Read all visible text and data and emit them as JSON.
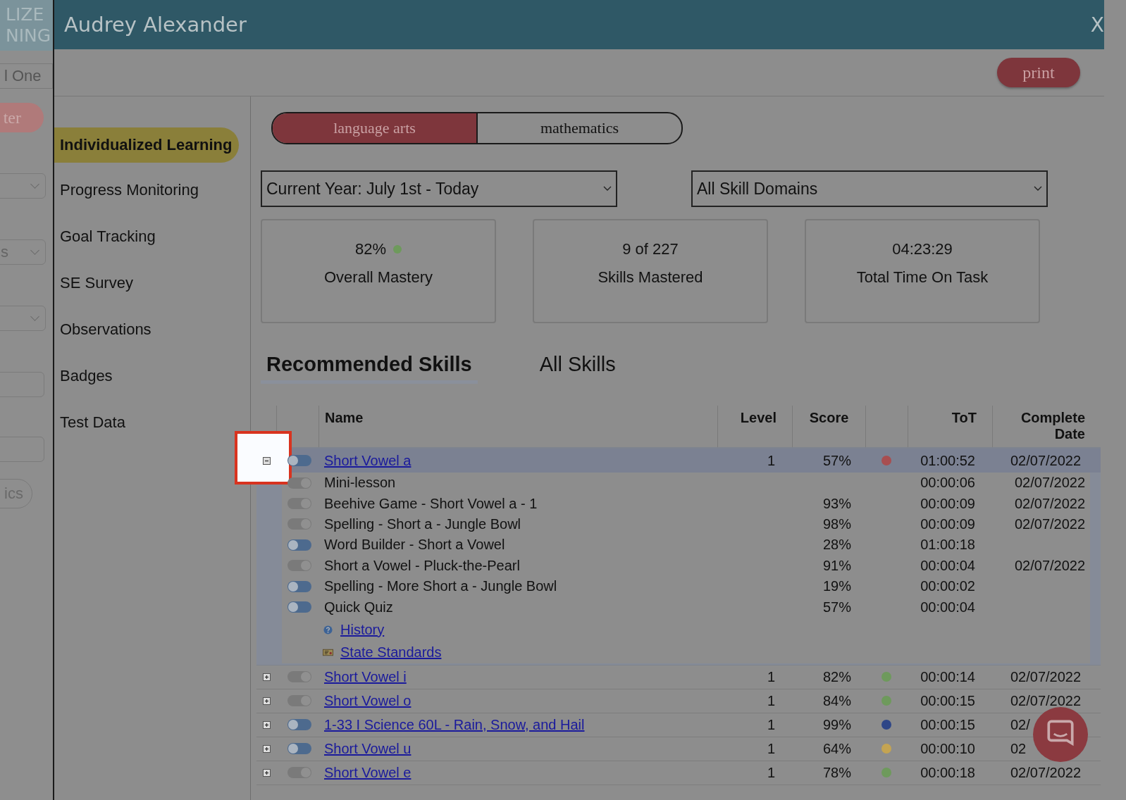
{
  "background_app": {
    "logo_lines": [
      "LIZE",
      "NING"
    ],
    "school": "l One",
    "button": "ter",
    "select_fragment": "s",
    "button_2": "ics"
  },
  "window": {
    "title": "Audrey Alexander",
    "close": "X"
  },
  "toolbar": {
    "print": "print"
  },
  "sidebar": {
    "items": [
      {
        "label": "Individualized Learning",
        "selected": true
      },
      {
        "label": "Progress Monitoring",
        "selected": false
      },
      {
        "label": "Goal Tracking",
        "selected": false
      },
      {
        "label": "SE Survey",
        "selected": false
      },
      {
        "label": "Observations",
        "selected": false
      },
      {
        "label": "Badges",
        "selected": false
      },
      {
        "label": "Test Data",
        "selected": false
      }
    ]
  },
  "subjects": [
    {
      "label": "language arts",
      "selected": true
    },
    {
      "label": "mathematics",
      "selected": false
    }
  ],
  "filters": [
    {
      "value": "Current Year: July 1st - Today"
    },
    {
      "value": "All Skill Domains"
    }
  ],
  "stats": [
    {
      "value": "82%",
      "label": "Overall Mastery",
      "color": "#6e9a5c"
    },
    {
      "value": "9 of 227",
      "label": "Skills Mastered"
    },
    {
      "value": "04:23:29",
      "label": "Total Time On Task"
    }
  ],
  "skill_tabs": [
    {
      "label": "Recommended Skills",
      "selected": true
    },
    {
      "label": "All Skills",
      "selected": false
    }
  ],
  "table": {
    "columns": {
      "name": "Name",
      "level": "Level",
      "score": "Score",
      "tot": "ToT",
      "date": "Complete Date"
    },
    "rows": [
      {
        "name": "Short Vowel a",
        "level": "1",
        "score": "57%",
        "color": "#a84e50",
        "tot": "01:00:52",
        "date": "02/07/2022",
        "completed": false,
        "expanded": true,
        "spotlighted": true,
        "children": [
          {
            "name": "Mini-lesson",
            "tot": "00:00:06",
            "date": "02/07/2022",
            "completed": true
          },
          {
            "name": "Beehive Game - Short Vowel a - 1",
            "score": "93%",
            "tot": "00:00:09",
            "date": "02/07/2022",
            "completed": true
          },
          {
            "name": "Spelling - Short a - Jungle Bowl",
            "score": "98%",
            "tot": "00:00:09",
            "date": "02/07/2022",
            "completed": true
          },
          {
            "name": "Word Builder - Short a Vowel",
            "score": "28%",
            "tot": "01:00:18",
            "completed": false
          },
          {
            "name": "Short a Vowel - Pluck-the-Pearl",
            "score": "91%",
            "tot": "00:00:04",
            "date": "02/07/2022",
            "completed": true
          },
          {
            "name": "Spelling - More Short a - Jungle Bowl",
            "score": "19%",
            "tot": "00:00:02",
            "completed": false
          },
          {
            "name": "Quick Quiz",
            "score": "57%",
            "tot": "00:00:04",
            "completed": false
          }
        ],
        "links": [
          {
            "label": "History",
            "kind": "help"
          },
          {
            "label": "State Standards",
            "kind": "certificate"
          }
        ]
      },
      {
        "name": "Short Vowel i",
        "level": "1",
        "score": "82%",
        "color": "#6e9a5c",
        "tot": "00:00:14",
        "date": "02/07/2022",
        "completed": true,
        "expanded": false
      },
      {
        "name": "Short Vowel o",
        "level": "1",
        "score": "84%",
        "color": "#6e9a5c",
        "tot": "00:00:15",
        "date": "02/07/2022",
        "completed": true,
        "expanded": false
      },
      {
        "name": "1-33 I Science 60L - Rain, Snow, and Hail",
        "level": "1",
        "score": "99%",
        "color": "#2e4687",
        "tot": "00:00:15",
        "date": "02/",
        "completed": false,
        "expanded": false
      },
      {
        "name": "Short Vowel u",
        "level": "1",
        "score": "64%",
        "color": "#c4a452",
        "tot": "00:00:10",
        "date": "02",
        "completed": false,
        "expanded": false
      },
      {
        "name": "Short Vowel e",
        "level": "1",
        "score": "78%",
        "color": "#6e9a5c",
        "tot": "00:00:18",
        "date": "02/07/2022",
        "completed": true,
        "expanded": false
      }
    ]
  }
}
